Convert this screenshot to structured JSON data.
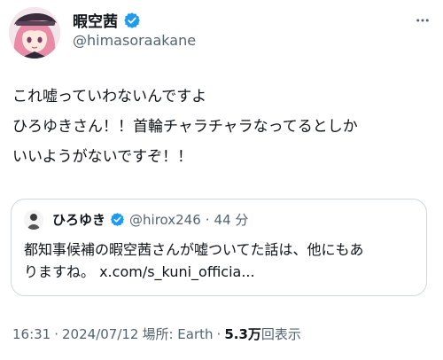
{
  "author": {
    "display_name": "暇空茜",
    "handle": "@himasoraakane",
    "avatar_icon": "anime-avatar-icon",
    "verified_icon": "verified-badge-icon"
  },
  "more_icon": "more-options-icon",
  "tweet": {
    "lines": [
      "これ嘘っていわないんですよ",
      "ひろゆきさん！！首輪チャラチャラなってるとしか",
      "いいようがないですぞ！！"
    ]
  },
  "quote": {
    "name": "ひろゆき",
    "handle": "@hirox246",
    "separator": "·",
    "time": "44 分",
    "lines": [
      "都知事候補の暇空茜さんが嘘ついてた話は、他にもあ",
      "りますね。 x.com/s_kuni_officia..."
    ]
  },
  "meta": {
    "time": "16:31",
    "sep1": "·",
    "date": "2024/07/12",
    "location": "場所: Earth",
    "sep2": "·",
    "views_num": "5.3万",
    "views_label": "回表示"
  },
  "colors": {
    "verified": "#1d9bf0",
    "text": "#0f1419",
    "secondary": "#536471",
    "border": "#cfd9de"
  }
}
